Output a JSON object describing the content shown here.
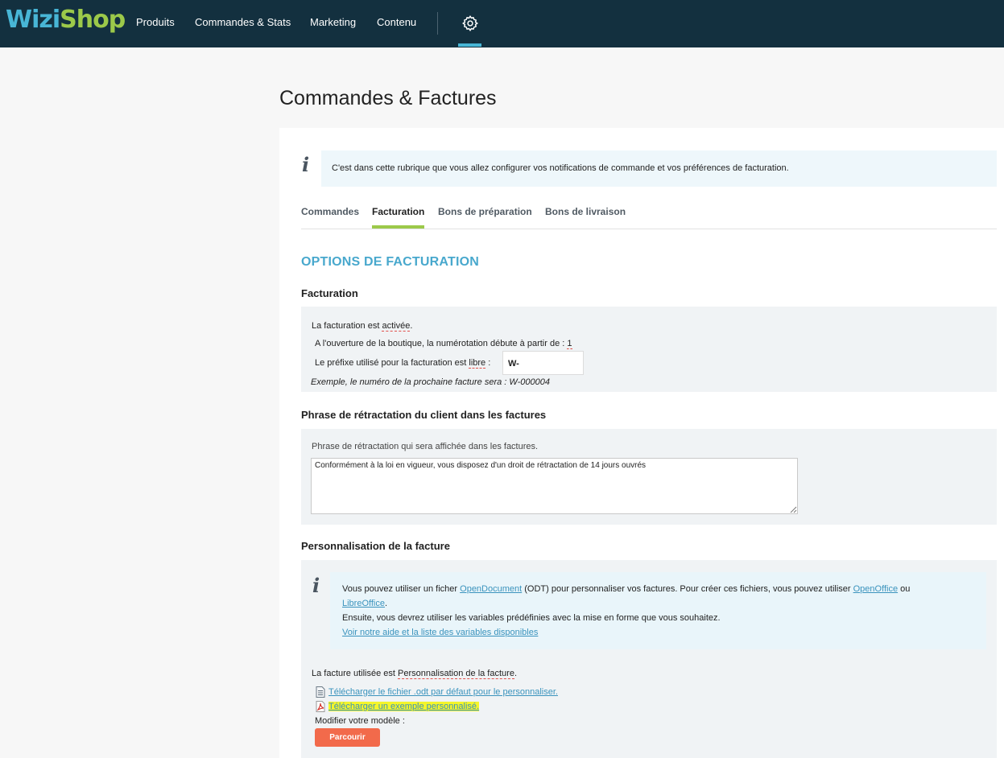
{
  "brand": {
    "logo_part1": "Wizi",
    "logo_part2": "Shop"
  },
  "topnav": {
    "items": [
      "Produits",
      "Commandes & Stats",
      "Marketing",
      "Contenu"
    ],
    "settings_icon": "gear-icon"
  },
  "page": {
    "title": "Commandes & Factures"
  },
  "intro": {
    "text": "C'est dans cette rubrique que vous allez configurer vos notifications de commande et vos préférences de facturation."
  },
  "tabs": [
    {
      "label": "Commandes",
      "active": false
    },
    {
      "label": "Facturation",
      "active": true
    },
    {
      "label": "Bons de préparation",
      "active": false
    },
    {
      "label": "Bons de livraison",
      "active": false
    }
  ],
  "options": {
    "title": "OPTIONS DE FACTURATION",
    "facturation": {
      "heading": "Facturation",
      "status_prefix": "La facturation est ",
      "status_value": "activée",
      "status_suffix": ".",
      "numbering_text": "A l'ouverture de la boutique, la numérotation débute à partir de : ",
      "numbering_value": "1",
      "prefix_text_before": "Le préfixe utilisé pour la facturation est ",
      "prefix_mode": "libre",
      "prefix_text_after": " :",
      "prefix_value": "W-",
      "example": "Exemple, le numéro de la prochaine facture sera : W-000004"
    },
    "retractation": {
      "heading": "Phrase de rétractation du client dans les factures",
      "label": "Phrase de rétractation qui sera affichée dans les factures.",
      "value": "Conformément à la loi en vigueur, vous disposez d'un droit de rétractation de 14 jours ouvrés"
    },
    "personnalisation": {
      "heading": "Personnalisation de la facture",
      "info_line1_a": "Vous pouvez utiliser un ficher ",
      "info_link_odf": "OpenDocument",
      "info_line1_b": " (ODT) pour personnaliser vos factures. Pour créer ces fichiers, vous pouvez utiliser ",
      "info_link_oo": "OpenOffice",
      "info_line1_c": " ou",
      "info_link_lo": "LibreOffice",
      "info_line2_end": ".",
      "info_line3": "Ensuite, vous devrez utiliser les variables prédéfinies avec la mise en forme que vous souhaitez.",
      "info_link_help": "Voir notre aide et la liste des variables disponibles",
      "used_prefix": "La facture utilisée est ",
      "used_value": "Personnalisation de la facture",
      "used_suffix": ".",
      "download_odt": "Télécharger le fichier .odt par défaut pour le personnaliser.",
      "download_example": "Télécharger un exemple personnalisé.",
      "modify_label": "Modifier votre modèle :",
      "browse_button": "Parcourir"
    }
  },
  "colors": {
    "topbar": "#13303f",
    "accent_blue": "#48b6d6",
    "accent_green": "#9cc94a",
    "button_orange": "#f26a4b"
  }
}
